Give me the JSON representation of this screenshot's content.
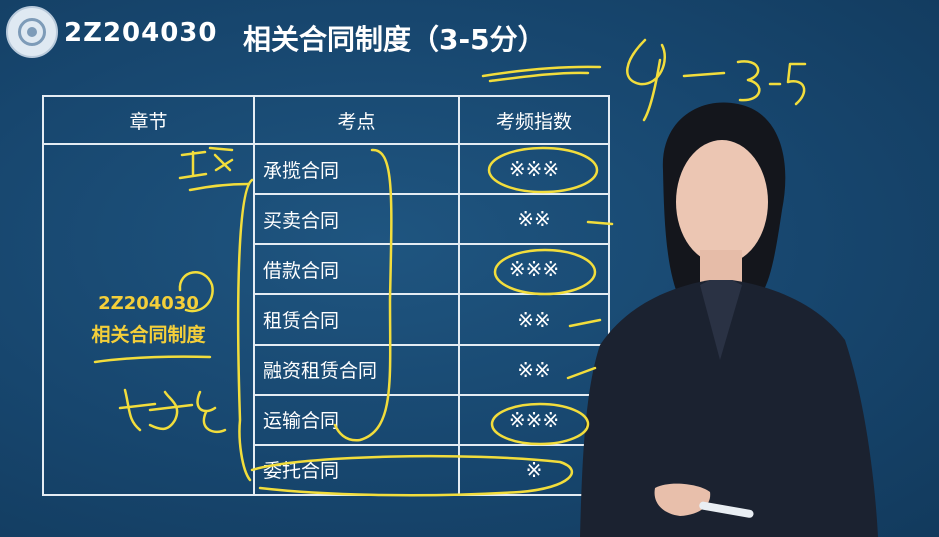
{
  "header": {
    "course_code": "2Z204030",
    "title": "相关合同制度（3-5分）"
  },
  "table": {
    "columns": [
      "章节",
      "考点",
      "考频指数"
    ],
    "chapter": {
      "code": "2Z204030",
      "name": "相关合同制度"
    },
    "rows": [
      {
        "topic": "承揽合同",
        "frequency": "※※※"
      },
      {
        "topic": "买卖合同",
        "frequency": "※※"
      },
      {
        "topic": "借款合同",
        "frequency": "※※※"
      },
      {
        "topic": "租赁合同",
        "frequency": "※※"
      },
      {
        "topic": "融资租赁合同",
        "frequency": "※※"
      },
      {
        "topic": "运输合同",
        "frequency": "※※※"
      },
      {
        "topic": "委托合同",
        "frequency": "※"
      }
    ]
  },
  "annotations": {
    "score_note": "4 — 3-5",
    "handwritten_1": "工程",
    "handwritten_2": "好多"
  },
  "colors": {
    "background": "#17466e",
    "table_line": "#e4ecf3",
    "chapter_text": "#f4cf3a",
    "ink": "#f2dd3c"
  }
}
